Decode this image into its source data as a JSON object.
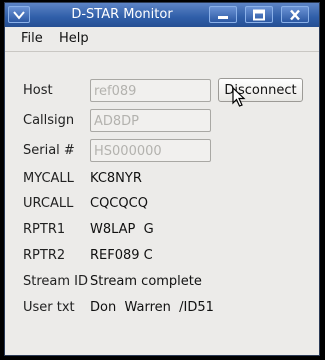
{
  "window": {
    "title": "D-STAR Monitor",
    "icons": {
      "sysmenu": "chevron-down-icon",
      "minimize": "minimize-icon",
      "maximize": "maximize-icon",
      "close": "close-icon"
    }
  },
  "menu": {
    "file": "File",
    "help": "Help"
  },
  "connection": {
    "host_label": "Host",
    "host_value": "ref089",
    "callsign_label": "Callsign",
    "callsign_value": "AD8DP",
    "serial_label": "Serial #",
    "serial_value": "HS000000",
    "disconnect_label": "Disconnect"
  },
  "stream": {
    "mycall_label": "MYCALL",
    "mycall_value": "KC8NYR",
    "urcall_label": "URCALL",
    "urcall_value": "CQCQCQ",
    "rptr1_label": "RPTR1",
    "rptr1_value": "W8LAP  G",
    "rptr2_label": "RPTR2",
    "rptr2_value": "REF089 C",
    "streamid_label": "Stream ID",
    "streamid_value": "Stream complete",
    "usertxt_label": "User txt",
    "usertxt_value": "Don  Warren  /ID51"
  },
  "colors": {
    "titlebar": "#2f5ea8",
    "window_bg": "#ecebe9",
    "disabled_text": "#b3b2ae"
  }
}
